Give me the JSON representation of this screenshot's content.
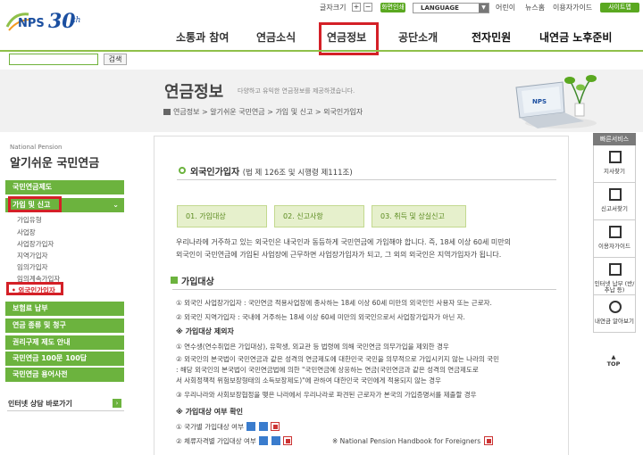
{
  "utility": {
    "font_size_label": "글자크기",
    "plus": "+",
    "minus": "−",
    "print": "화면인쇄",
    "language": "LANGUAGE",
    "language_caret": "▼",
    "kids": "어린이",
    "newsletter": "뉴스홈",
    "usage_guide": "이용자가이드",
    "sitemap": "사이트맵"
  },
  "logo": {
    "nps": "NPS",
    "number": "30",
    "suffix": "th"
  },
  "gnb": [
    "소통과 참여",
    "연금소식",
    "연금정보",
    "공단소개",
    "전자민원",
    "내연금 노후준비"
  ],
  "search": {
    "value": "",
    "button": "검색"
  },
  "page": {
    "title": "연금정보",
    "description": "다양하고 유익한 연금정보를 제공하겠습니다.",
    "breadcrumb": "연금정보 > 알기쉬운 국민연금 > 가입 및 신고 > 외국인가입자"
  },
  "side": {
    "subtitle": "National Pension",
    "title": "알기쉬운 국민연금",
    "menu_system": "국민연금제도",
    "menu_join": "가입 및 신고",
    "menu_join_chevron": "⌄",
    "sub": [
      "가입유형",
      "사업장",
      "사업장가입자",
      "지역가입자",
      "임의가입자",
      "임의계속가입자",
      "외국인가입자"
    ],
    "current_marker": "•",
    "menu_others": [
      "보험료 납부",
      "연금 종류 및 청구",
      "권리구제 제도 안내",
      "국민연금 100문 100답",
      "국민연금 용어사전"
    ],
    "chat": "인터넷 상담 바로가기",
    "chat_arrow": "›"
  },
  "content": {
    "heading": "외국인가입자",
    "law": "(법 제 126조 및 시행령 제111조)",
    "tabs": [
      "01. 가입대상",
      "02. 신고사항",
      "03. 취득 및 상실신고"
    ],
    "intro_1": "우리나라에 거주하고 있는 외국인은 내국인과 동등하게 국민연금에 가입해야 합니다. 즉, 18세 이상 60세 미만의",
    "intro_2": "외국인이 국민연금에 가입된 사업장에 근무하면 사업장가입자가 되고, 그 외의 외국인은 지역가입자가 됩니다.",
    "section": "가입대상",
    "target_1": "① 외국인 사업장가입자 : 국민연금 적용사업장에 종사하는 18세 이상 60세 미만의 외국인인 사용자 또는 근로자.",
    "target_2": "② 외국인 지역가입자 : 국내에 거주하는 18세 이상 60세 미만의 외국인으로서 사업장가입자가 아닌 자.",
    "exclusion_title": "※ 가입대상 제외자",
    "exclusion_1": "① 연수생(연수취업은 가입대상), 유학생, 외교관 등 법령에 의해 국민연금 의무가입을 제외한 경우",
    "exclusion_2": "② 외국인의 본국법이 국민연금과 같은 성격의 연금제도에 대한민국 국민을 의무적으로 가입시키지 않는 나라의 국민",
    "exclusion_2b": "  : 해당 외국인의 본국법이 국민연금법에 의한 \"국민연금에 상응하는 연금(국민연금과 같은 성격의 연금제도로",
    "exclusion_2c": "    서 사회정책적 위험보장형태의 소득보장제도)\"에 관하여 대한민국 국민에게 적용되지 않는 경우",
    "exclusion_3": "③ 우리나라와 사회보장협정을 맺은 나라에서 우리나라로 파견된 근로자가 본국의 가입증명서를 제출할 경우",
    "check_title": "※ 가입대상 여부 확인",
    "check_1": "① 국가별 가입대상 여부",
    "check_2": "② 체류자격별 가입대상 여부",
    "handbook": "※ National Pension Handbook for Foreigners"
  },
  "quick": {
    "header": "빠른서비스",
    "items": [
      "지사찾기",
      "신고서찾기",
      "이용자가이드",
      "인터넷 납부 (반/추납 등)",
      "내연금 알아보기"
    ],
    "top": "TOP"
  },
  "colors": {
    "brand_green": "#6cb33e",
    "highlight_red": "#d42027",
    "brand_blue": "#1b4fa0"
  }
}
